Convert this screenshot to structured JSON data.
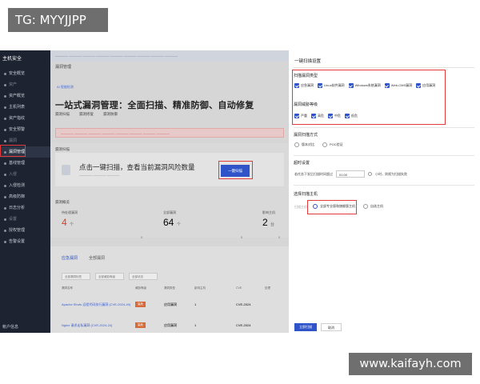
{
  "tag": "TG: MYYJJPP",
  "watermark": "www.kaifayh.com",
  "sidebar": {
    "logo": "主机安全",
    "items": [
      {
        "label": "安全概览",
        "type": "item"
      },
      {
        "label": "资产",
        "type": "group"
      },
      {
        "label": "资产概览",
        "type": "item"
      },
      {
        "label": "主机列表",
        "type": "item"
      },
      {
        "label": "资产指纹",
        "type": "item"
      },
      {
        "label": "安全预警",
        "type": "item"
      },
      {
        "label": "漏洞",
        "type": "group"
      },
      {
        "label": "漏洞管理",
        "type": "active"
      },
      {
        "label": "基线管理",
        "type": "item"
      },
      {
        "label": "入侵",
        "type": "group"
      },
      {
        "label": "入侵检测",
        "type": "item"
      },
      {
        "label": "高级防御",
        "type": "item"
      },
      {
        "label": "日志分析",
        "type": "item"
      },
      {
        "label": "设置",
        "type": "group"
      },
      {
        "label": "授权管理",
        "type": "item"
      },
      {
        "label": "告警设置",
        "type": "item"
      }
    ],
    "footer": "帐户信息"
  },
  "main": {
    "page_head": "漏洞管理",
    "ai_line": "AI 智能检测",
    "hero_title": "一站式漏洞管理：全面扫描、精准防御、自动修复",
    "hero_tabs": [
      "漏洞扫描",
      "漏洞修复",
      "漏洞防御"
    ],
    "scan_label": "漏洞扫描",
    "scan_text": "点击一键扫描，查看当前漏洞风险数量",
    "scan_button": "一键扫描",
    "overview_label": "漏洞概览",
    "stats": [
      {
        "caption": "待处理漏洞",
        "value": "4",
        "unit": "个",
        "color": "#d9412b",
        "foot": "0"
      },
      {
        "caption": "全部漏洞",
        "value": "64",
        "unit": "个",
        "color": "#222222",
        "foot": "0"
      },
      {
        "caption": "影响主机",
        "value": "2",
        "unit": "台",
        "color": "#222222",
        "foot": "0"
      }
    ],
    "list_tabs": [
      "应急漏洞",
      "全部漏洞"
    ],
    "filters": [
      "全部漏洞标签",
      "全部威胁等级",
      "全部状态"
    ],
    "table_headers": [
      "漏洞名称",
      "威胁等级",
      "漏洞类型",
      "影响主机",
      "CVE",
      "处理"
    ],
    "rows": [
      {
        "name": "Apache Struts 远程代码执行漏洞 (CVE-2024-40)",
        "level": "高危",
        "type": "应用漏洞",
        "host": "1",
        "cve": "CVE-2024"
      },
      {
        "name": "Nginx 请求走私漏洞 (CVE-2024-24)",
        "level": "高危",
        "type": "应用漏洞",
        "host": "1",
        "cve": "CVE-2024"
      }
    ]
  },
  "drawer": {
    "title": "一键扫描设置",
    "scan_types_title": "扫描漏洞类型",
    "scan_types": [
      "应急漏洞",
      "Linux软件漏洞",
      "Windows系统漏洞",
      "Web-CMS漏洞",
      "应用漏洞"
    ],
    "levels_title": "漏洞威胁等级",
    "levels": [
      "严重",
      "高危",
      "中危",
      "低危"
    ],
    "method_title": "漏洞扫描方式",
    "methods": [
      "版本对比",
      "POC验证"
    ],
    "timeout_title": "超时设置",
    "timeout_prefix": "若任务下发后扫描时间超过",
    "timeout_value": "01:00",
    "timeout_suffix": "小时，则视为扫描失败",
    "host_title": "选择扫描主机",
    "host_prefix": "扫描主机",
    "host_options": [
      "全部专业版和旗舰版主机",
      "自选主机"
    ],
    "ok_button": "立即扫描",
    "cancel_button": "取消"
  }
}
